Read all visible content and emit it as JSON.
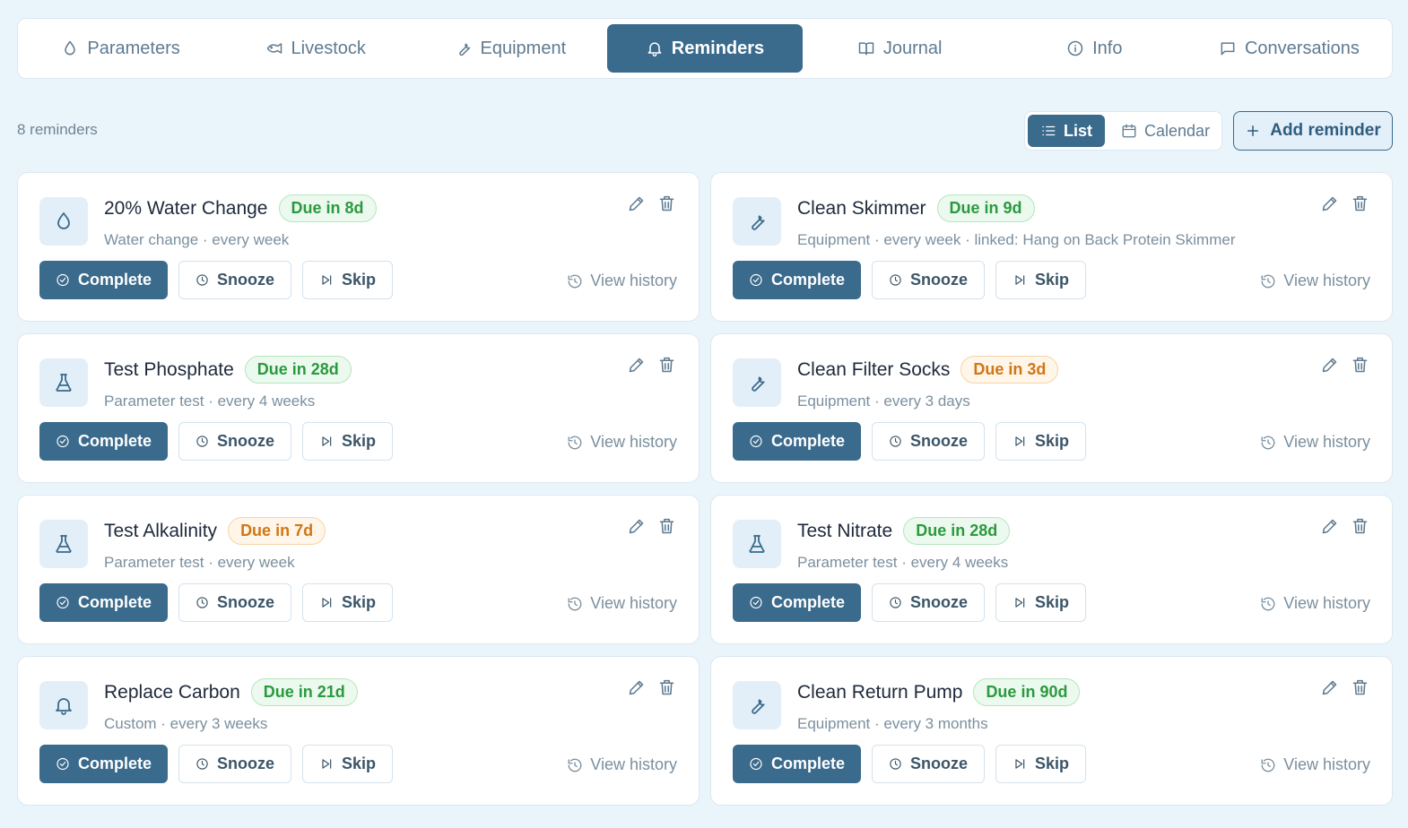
{
  "tabs": [
    {
      "label": "Parameters",
      "icon": "droplet-icon",
      "active": false
    },
    {
      "label": "Livestock",
      "icon": "fish-icon",
      "active": false
    },
    {
      "label": "Equipment",
      "icon": "wrench-icon",
      "active": false
    },
    {
      "label": "Reminders",
      "icon": "bell-icon",
      "active": true
    },
    {
      "label": "Journal",
      "icon": "book-icon",
      "active": false
    },
    {
      "label": "Info",
      "icon": "info-icon",
      "active": false
    },
    {
      "label": "Conversations",
      "icon": "chat-icon",
      "active": false
    }
  ],
  "toolbar": {
    "count": "8 reminders",
    "view_list": "List",
    "view_calendar": "Calendar",
    "active_view": "List",
    "add_label": "Add reminder"
  },
  "actions": {
    "complete": "Complete",
    "snooze": "Snooze",
    "skip": "Skip",
    "history": "View history"
  },
  "reminders": [
    {
      "title": "20% Water Change",
      "due": "Due in 8d",
      "status": "green",
      "subtitle": "Water change · every week",
      "icon": "droplet-icon"
    },
    {
      "title": "Clean Skimmer",
      "due": "Due in 9d",
      "status": "green",
      "subtitle": "Equipment · every week · linked: Hang on Back Protein Skimmer",
      "icon": "wrench-icon"
    },
    {
      "title": "Test Phosphate",
      "due": "Due in 28d",
      "status": "green",
      "subtitle": "Parameter test · every 4 weeks",
      "icon": "flask-icon"
    },
    {
      "title": "Clean Filter Socks",
      "due": "Due in 3d",
      "status": "orange",
      "subtitle": "Equipment · every 3 days",
      "icon": "wrench-icon"
    },
    {
      "title": "Test Alkalinity",
      "due": "Due in 7d",
      "status": "orange",
      "subtitle": "Parameter test · every week",
      "icon": "flask-icon"
    },
    {
      "title": "Test Nitrate",
      "due": "Due in 28d",
      "status": "green",
      "subtitle": "Parameter test · every 4 weeks",
      "icon": "flask-icon"
    },
    {
      "title": "Replace Carbon",
      "due": "Due in 21d",
      "status": "green",
      "subtitle": "Custom · every 3 weeks",
      "icon": "bell-icon"
    },
    {
      "title": "Clean Return Pump",
      "due": "Due in 90d",
      "status": "green",
      "subtitle": "Equipment · every 3 months",
      "icon": "wrench-icon"
    }
  ],
  "colors": {
    "primary": "#3a6a8c",
    "background": "#eaf4fb",
    "due_green": "#2a9a3e",
    "due_orange": "#d27614"
  }
}
